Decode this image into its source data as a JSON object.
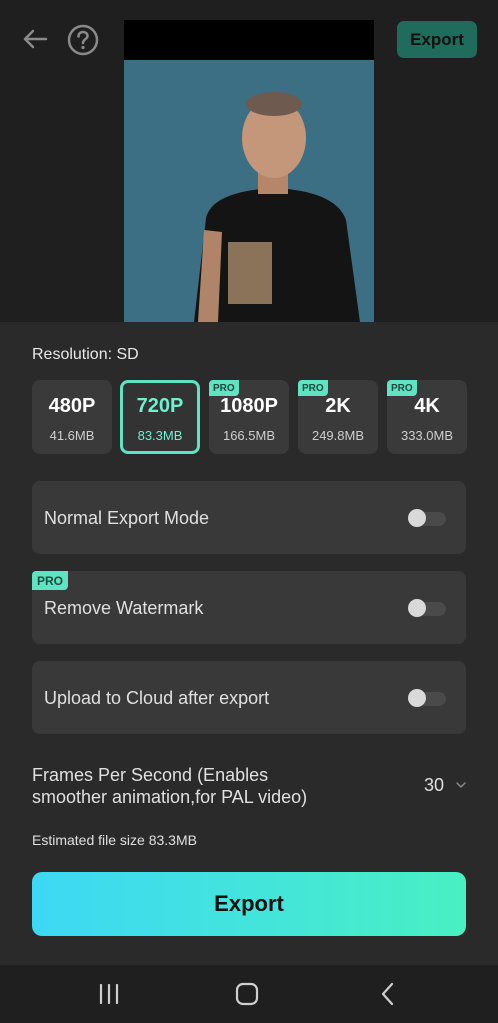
{
  "header": {
    "export_label": "Export",
    "back_icon": "arrow-left-icon",
    "help_icon": "question-circle-icon"
  },
  "resolution": {
    "title": "Resolution: SD",
    "options": [
      {
        "label": "480P",
        "size": "41.6MB",
        "pro": false,
        "selected": false
      },
      {
        "label": "720P",
        "size": "83.3MB",
        "pro": false,
        "selected": true
      },
      {
        "label": "1080P",
        "size": "166.5MB",
        "pro": true,
        "selected": false
      },
      {
        "label": "2K",
        "size": "249.8MB",
        "pro": true,
        "selected": false
      },
      {
        "label": "4K",
        "size": "333.0MB",
        "pro": true,
        "selected": false
      }
    ],
    "pro_badge": "PRO"
  },
  "options": {
    "normal_export": {
      "label": "Normal Export Mode",
      "enabled": false
    },
    "remove_watermark": {
      "label": "Remove Watermark",
      "enabled": false,
      "badge": "PRO"
    },
    "upload_cloud": {
      "label": "Upload to Cloud after export",
      "enabled": false
    }
  },
  "fps": {
    "label": "Frames Per Second (Enables smoother animation,for PAL video)",
    "value": "30"
  },
  "estimated_size": "Estimated file size 83.3MB",
  "export_button": "Export",
  "colors": {
    "accent": "#5fe3c2",
    "export_gradient_start": "#3dd8f5",
    "export_gradient_end": "#48f0c2"
  },
  "navbar": {
    "recents_icon": "recents-icon",
    "home_icon": "home-icon",
    "back_icon": "nav-back-icon"
  }
}
